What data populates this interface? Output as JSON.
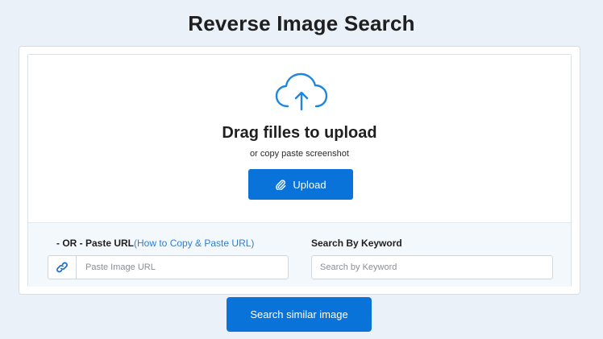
{
  "header": {
    "title": "Reverse Image Search"
  },
  "upload": {
    "icon": "cloud-upload-icon",
    "title": "Drag filles to upload",
    "subtitle": "or copy paste screenshot",
    "button_label": "Upload",
    "button_icon": "paperclip-icon"
  },
  "url_section": {
    "label_prefix": "- OR - Paste URL",
    "help_link": "(How to Copy & Paste URL)",
    "icon": "link-icon",
    "placeholder": "Paste Image URL",
    "value": ""
  },
  "keyword_section": {
    "label": "Search By Keyword",
    "placeholder": "Search by Keyword",
    "value": ""
  },
  "search_button": {
    "label": "Search similar image"
  },
  "colors": {
    "accent": "#0a73d9",
    "link": "#2b7fd4",
    "page_bg": "#eaf1f9",
    "panel_bg": "#f3f8fd"
  }
}
